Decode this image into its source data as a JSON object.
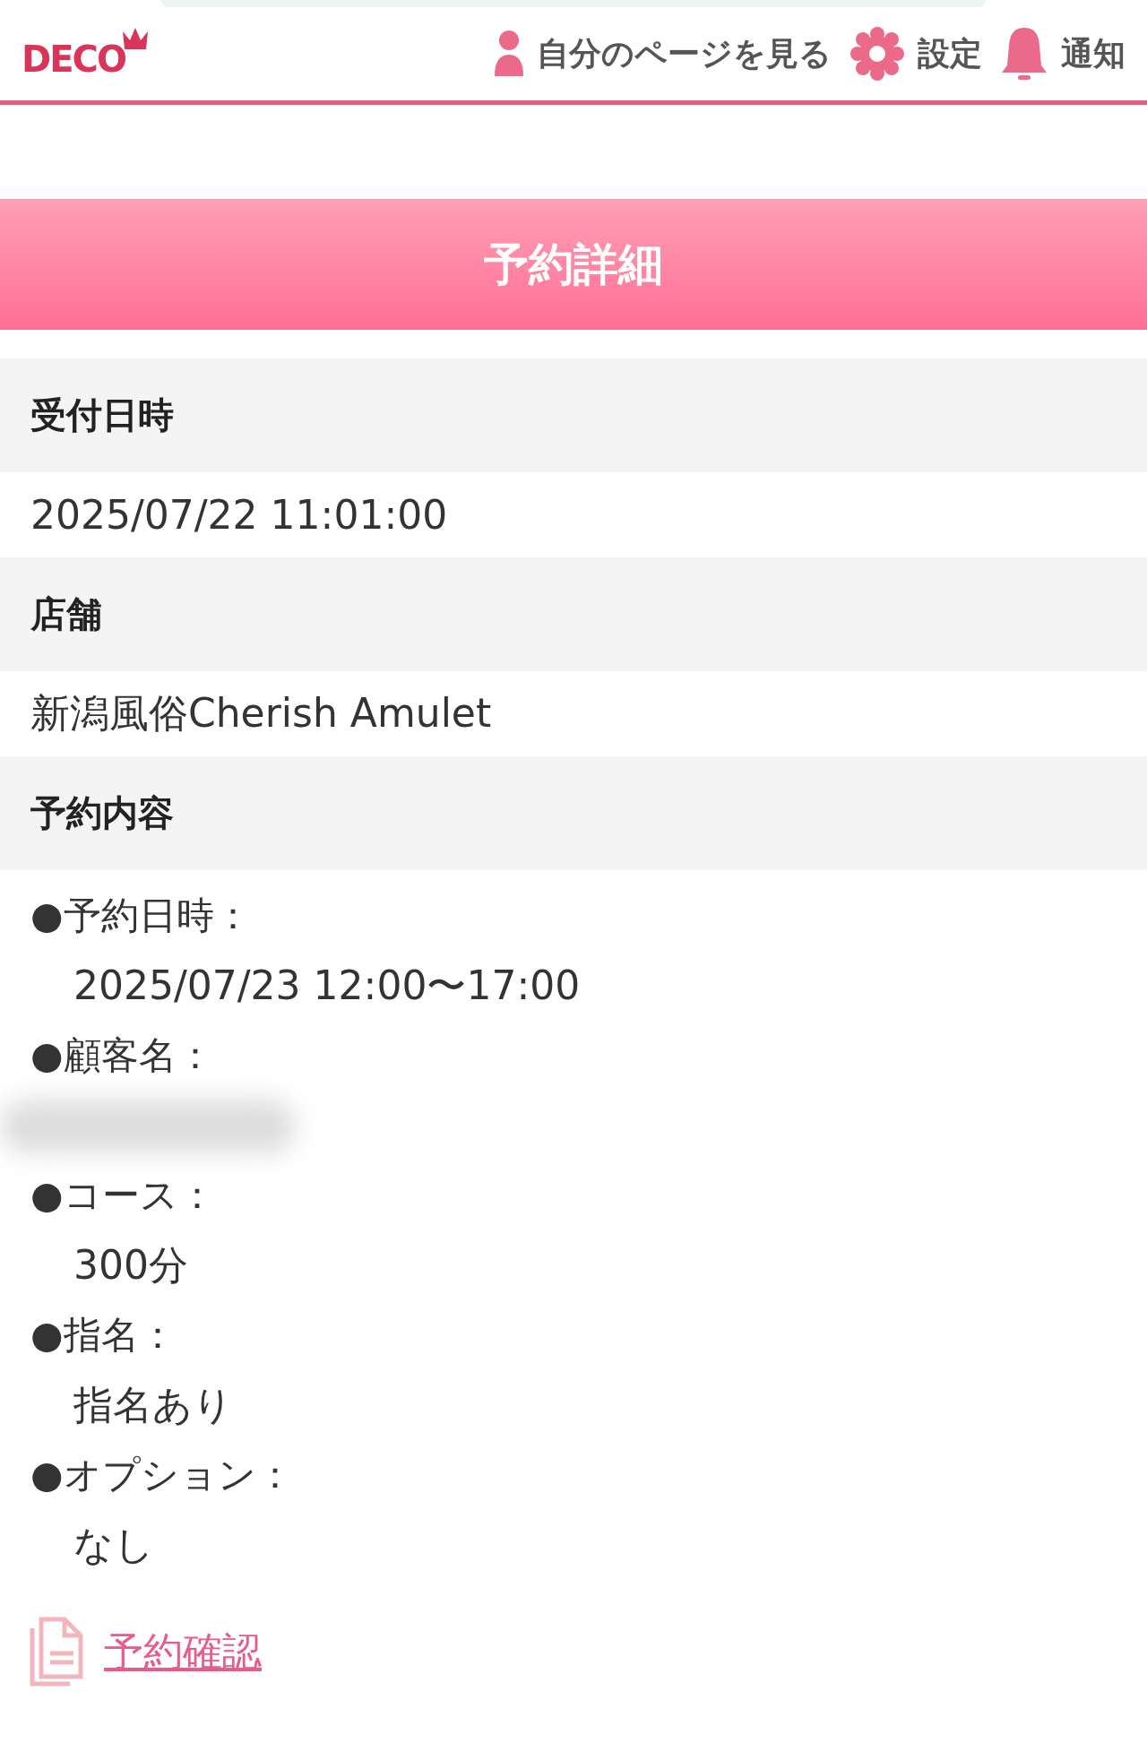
{
  "header": {
    "logo": "DECO",
    "nav": [
      {
        "kind": "profile",
        "label": "自分のページを見る"
      },
      {
        "kind": "settings",
        "label": "設定"
      },
      {
        "kind": "bell",
        "label": "通知"
      }
    ]
  },
  "title": "予約詳細",
  "sections": [
    {
      "heading": "受付日時",
      "value": "2025/07/22 11:01:00"
    },
    {
      "heading": "店舗",
      "value": "新潟風俗Cherish Amulet"
    },
    {
      "heading": "予約内容",
      "details": [
        {
          "kind": "text",
          "label": "●予約日時：",
          "value": "2025/07/23 12:00〜17:00"
        },
        {
          "kind": "blurred",
          "label": "●顧客名："
        },
        {
          "kind": "text",
          "label": "●コース：",
          "value": "300分"
        },
        {
          "kind": "text",
          "label": "●指名：",
          "value": "指名あり"
        },
        {
          "kind": "text",
          "label": "●オプション：",
          "value": "なし"
        }
      ]
    }
  ],
  "link": "予約確認"
}
